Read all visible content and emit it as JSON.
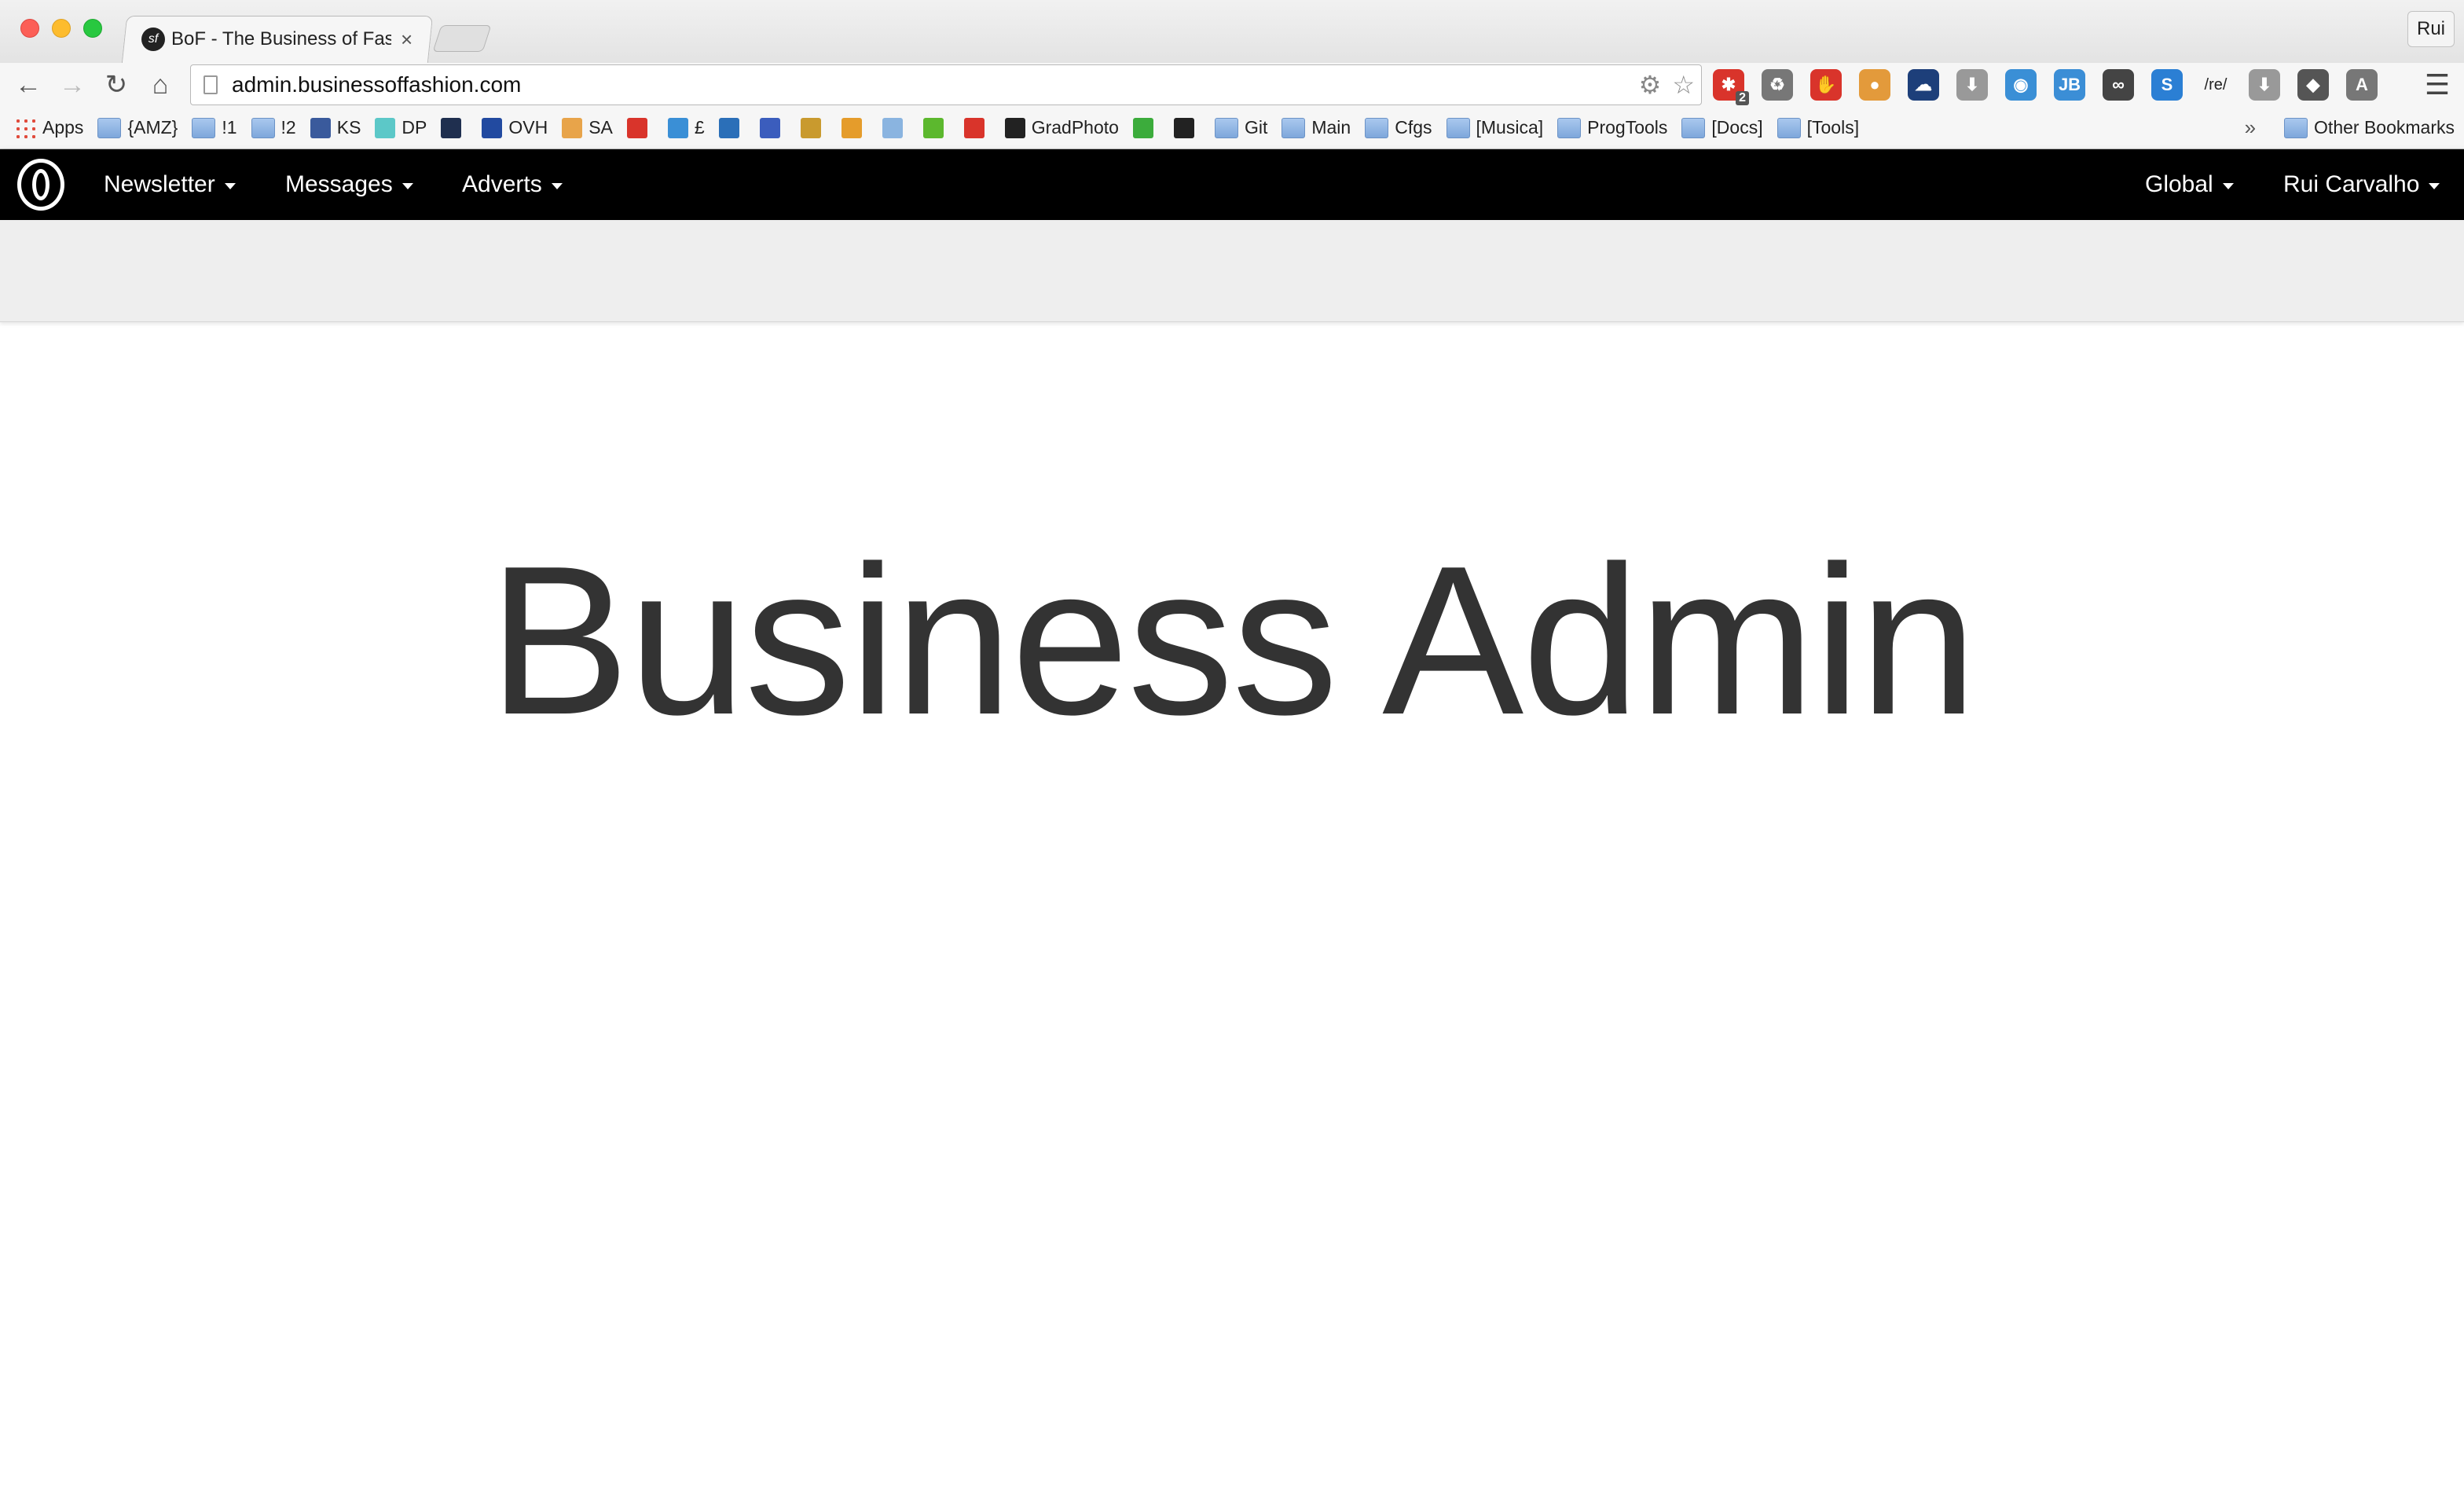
{
  "browser": {
    "tab_title": "BoF - The Business of Fashion",
    "tab_favicon": "sf",
    "tab_close": "×",
    "profile_name": "Rui",
    "url": "admin.businessoffashion.com",
    "icons": {
      "back": "back-arrow-icon",
      "forward": "forward-arrow-icon",
      "reload": "reload-icon",
      "home": "home-icon",
      "settings": "gear-icon",
      "star": "star-icon",
      "menu": "hamburger-menu-icon"
    },
    "extensions": [
      {
        "name": "lastpass-extension-icon",
        "color": "#d9342b",
        "glyph": "✱"
      },
      {
        "name": "recycle-extension-icon",
        "color": "#777777",
        "glyph": "♻"
      },
      {
        "name": "hand-stop-extension-icon",
        "color": "#d9342b",
        "glyph": "✋"
      },
      {
        "name": "cookie-extension-icon",
        "color": "#e39a3b",
        "glyph": "●"
      },
      {
        "name": "cloud-extension-icon",
        "color": "#1d3f7a",
        "glyph": "☁"
      },
      {
        "name": "download-extension-icon",
        "color": "#999999",
        "glyph": "⬇"
      },
      {
        "name": "globe-extension-icon",
        "color": "#3a8fd6",
        "glyph": "◉"
      },
      {
        "name": "jb-extension-icon",
        "color": "#3b8ed6",
        "glyph": "JB"
      },
      {
        "name": "mask-extension-icon",
        "color": "#444444",
        "glyph": "∞"
      },
      {
        "name": "s-extension-icon",
        "color": "#2b7fd4",
        "glyph": "S"
      },
      {
        "name": "regex-extension-icon",
        "color": "#ffffff",
        "glyph": "/re/"
      },
      {
        "name": "download2-extension-icon",
        "color": "#999999",
        "glyph": "⬇"
      },
      {
        "name": "pocket-extension-icon",
        "color": "#555555",
        "glyph": "◆"
      },
      {
        "name": "angular-extension-icon",
        "color": "#777777",
        "glyph": "A"
      }
    ],
    "extension_badge": "2",
    "bookmarks": [
      {
        "label": "Apps",
        "type": "apps"
      },
      {
        "label": "{AMZ}",
        "type": "folder"
      },
      {
        "label": "!1",
        "type": "folder"
      },
      {
        "label": "!2",
        "type": "folder"
      },
      {
        "label": "KS",
        "type": "site"
      },
      {
        "label": "DP",
        "type": "site"
      },
      {
        "label": "",
        "type": "site"
      },
      {
        "label": "OVH",
        "type": "site"
      },
      {
        "label": "SA",
        "type": "site"
      },
      {
        "label": "",
        "type": "site"
      },
      {
        "label": "£",
        "type": "site"
      },
      {
        "label": "",
        "type": "site"
      },
      {
        "label": "",
        "type": "site"
      },
      {
        "label": "",
        "type": "site"
      },
      {
        "label": "",
        "type": "site"
      },
      {
        "label": "",
        "type": "site"
      },
      {
        "label": "",
        "type": "site"
      },
      {
        "label": "",
        "type": "site"
      },
      {
        "label": "GradPhoto",
        "type": "site"
      },
      {
        "label": "",
        "type": "site"
      },
      {
        "label": "",
        "type": "site"
      },
      {
        "label": "Git",
        "type": "folder"
      },
      {
        "label": "Main",
        "type": "folder"
      },
      {
        "label": "Cfgs",
        "type": "folder"
      },
      {
        "label": "[Musica]",
        "type": "folder"
      },
      {
        "label": "ProgTools",
        "type": "folder"
      },
      {
        "label": "[Docs]",
        "type": "folder"
      },
      {
        "label": "[Tools]",
        "type": "folder"
      }
    ],
    "bookmarks_overflow": "»",
    "other_bookmarks": "Other Bookmarks"
  },
  "navbar": {
    "brand": "bof-logo",
    "left_items": [
      "Newsletter",
      "Messages",
      "Adverts"
    ],
    "right_items": [
      "Global",
      "Rui Carvalho"
    ]
  },
  "main": {
    "heading": "Business Admin"
  }
}
